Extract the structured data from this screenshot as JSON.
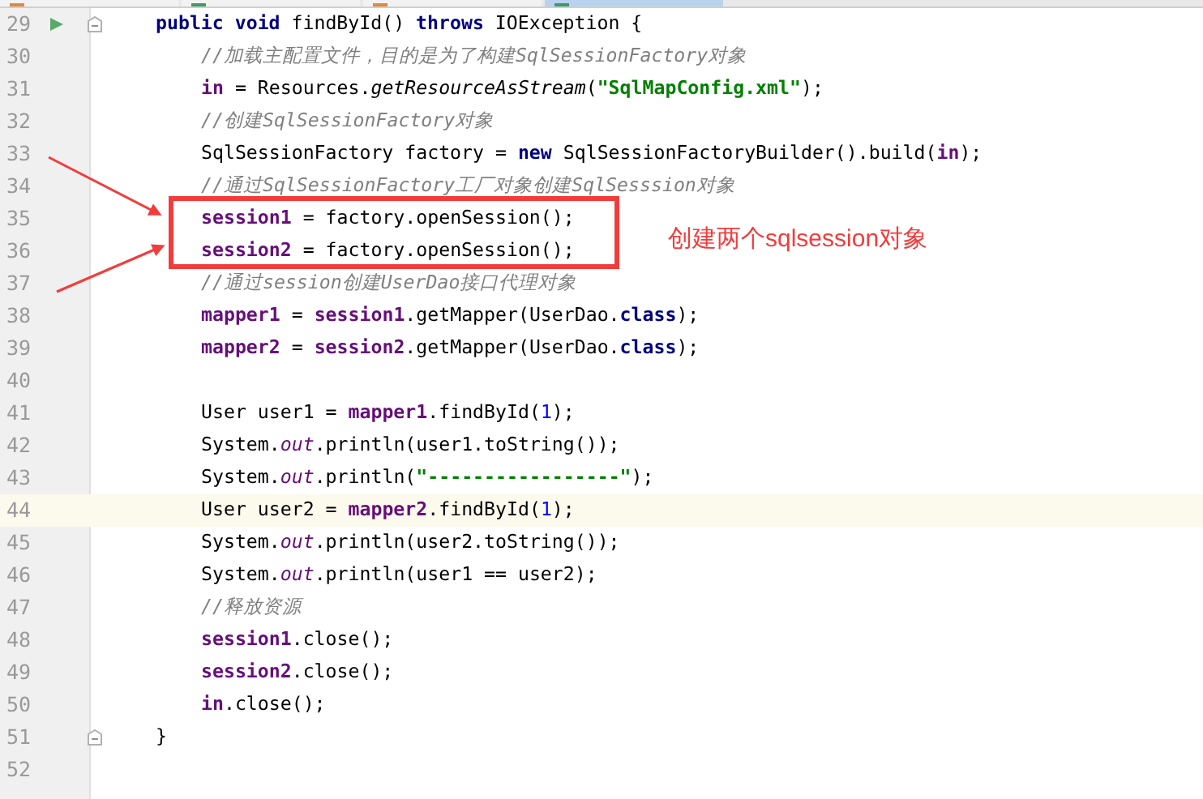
{
  "tabs": [
    {
      "kind": "xml",
      "selected": false
    },
    {
      "kind": "java",
      "selected": false
    },
    {
      "kind": "xml",
      "selected": false
    },
    {
      "kind": "java",
      "selected": true
    }
  ],
  "lines": [
    {
      "number": "29",
      "run_marker": true,
      "fold": true,
      "highlighted": false,
      "segments": [
        {
          "kind": "keyword",
          "text": "public void"
        },
        {
          "kind": "plain",
          "text": " findById() "
        },
        {
          "kind": "keyword",
          "text": "throws"
        },
        {
          "kind": "plain",
          "text": " IOException {"
        }
      ],
      "children": [
        {
          "number": "30",
          "run_marker": false,
          "fold": false,
          "highlighted": false,
          "segments": [
            {
              "kind": "comment",
              "text": "//加载主配置文件，目的是为了构建SqlSessionFactory对象"
            }
          ]
        },
        {
          "number": "31",
          "run_marker": false,
          "fold": false,
          "highlighted": false,
          "segments": [
            {
              "kind": "field",
              "text": "in"
            },
            {
              "kind": "plain",
              "text": " = Resources."
            },
            {
              "kind": "italic",
              "text": "getResourceAsStream"
            },
            {
              "kind": "plain",
              "text": "("
            },
            {
              "kind": "string",
              "text": "\"SqlMapConfig.xml\""
            },
            {
              "kind": "plain",
              "text": ");"
            }
          ]
        },
        {
          "number": "32",
          "run_marker": false,
          "fold": false,
          "highlighted": false,
          "segments": [
            {
              "kind": "comment",
              "text": "//创建SqlSessionFactory对象"
            }
          ]
        },
        {
          "number": "33",
          "run_marker": false,
          "fold": false,
          "highlighted": false,
          "segments": [
            {
              "kind": "plain",
              "text": "SqlSessionFactory factory = "
            },
            {
              "kind": "keyword",
              "text": "new"
            },
            {
              "kind": "plain",
              "text": " SqlSessionFactoryBuilder().build("
            },
            {
              "kind": "field",
              "text": "in"
            },
            {
              "kind": "plain",
              "text": ");"
            }
          ]
        },
        {
          "number": "34",
          "run_marker": false,
          "fold": false,
          "highlighted": false,
          "segments": [
            {
              "kind": "comment",
              "text": "//通过SqlSessionFactory工厂对象创建SqlSesssion对象"
            }
          ]
        },
        {
          "number": "35",
          "run_marker": false,
          "fold": false,
          "highlighted": false,
          "segments": [
            {
              "kind": "field",
              "text": "session1"
            },
            {
              "kind": "plain",
              "text": " = factory.openSession();"
            }
          ]
        },
        {
          "number": "36",
          "run_marker": false,
          "fold": false,
          "highlighted": false,
          "segments": [
            {
              "kind": "field",
              "text": "session2"
            },
            {
              "kind": "plain",
              "text": " = factory.openSession();"
            }
          ]
        },
        {
          "number": "37",
          "run_marker": false,
          "fold": false,
          "highlighted": false,
          "segments": [
            {
              "kind": "comment",
              "text": "//通过session创建UserDao接口代理对象"
            }
          ]
        },
        {
          "number": "38",
          "run_marker": false,
          "fold": false,
          "highlighted": false,
          "segments": [
            {
              "kind": "field",
              "text": "mapper1"
            },
            {
              "kind": "plain",
              "text": " = "
            },
            {
              "kind": "field",
              "text": "session1"
            },
            {
              "kind": "plain",
              "text": ".getMapper(UserDao."
            },
            {
              "kind": "keyword",
              "text": "class"
            },
            {
              "kind": "plain",
              "text": ");"
            }
          ]
        },
        {
          "number": "39",
          "run_marker": false,
          "fold": false,
          "highlighted": false,
          "segments": [
            {
              "kind": "field",
              "text": "mapper2"
            },
            {
              "kind": "plain",
              "text": " = "
            },
            {
              "kind": "field",
              "text": "session2"
            },
            {
              "kind": "plain",
              "text": ".getMapper(UserDao."
            },
            {
              "kind": "keyword",
              "text": "class"
            },
            {
              "kind": "plain",
              "text": ");"
            }
          ]
        },
        {
          "number": "40",
          "run_marker": false,
          "fold": false,
          "highlighted": false
        },
        {
          "number": "41",
          "run_marker": false,
          "fold": false,
          "highlighted": false,
          "segments": [
            {
              "kind": "plain",
              "text": "User user1 = "
            },
            {
              "kind": "field",
              "text": "mapper1"
            },
            {
              "kind": "plain",
              "text": ".findById("
            },
            {
              "kind": "number",
              "text": "1"
            },
            {
              "kind": "plain",
              "text": ");"
            }
          ]
        },
        {
          "number": "42",
          "run_marker": false,
          "fold": false,
          "highlighted": false,
          "segments": [
            {
              "kind": "plain",
              "text": "System."
            },
            {
              "kind": "static",
              "text": "out"
            },
            {
              "kind": "plain",
              "text": ".println(user1.toString());"
            }
          ]
        },
        {
          "number": "43",
          "run_marker": false,
          "fold": false,
          "highlighted": false,
          "segments": [
            {
              "kind": "plain",
              "text": "System."
            },
            {
              "kind": "static",
              "text": "out"
            },
            {
              "kind": "plain",
              "text": ".println("
            },
            {
              "kind": "string",
              "text": "\"-----------------\""
            },
            {
              "kind": "plain",
              "text": ");"
            }
          ]
        },
        {
          "number": "44",
          "run_marker": false,
          "fold": false,
          "highlighted": true,
          "segments": [
            {
              "kind": "plain",
              "text": "User user2 = "
            },
            {
              "kind": "field",
              "text": "mapper2"
            },
            {
              "kind": "plain",
              "text": ".findById("
            },
            {
              "kind": "number",
              "text": "1"
            },
            {
              "kind": "plain",
              "text": ");"
            }
          ]
        },
        {
          "number": "45",
          "run_marker": false,
          "fold": false,
          "highlighted": false,
          "segments": [
            {
              "kind": "plain",
              "text": "System."
            },
            {
              "kind": "static",
              "text": "out"
            },
            {
              "kind": "plain",
              "text": ".println(user2.toString());"
            }
          ]
        },
        {
          "number": "46",
          "run_marker": false,
          "fold": false,
          "highlighted": false,
          "segments": [
            {
              "kind": "plain",
              "text": "System."
            },
            {
              "kind": "static",
              "text": "out"
            },
            {
              "kind": "plain",
              "text": ".println(user1 == user2);"
            }
          ]
        },
        {
          "number": "47",
          "run_marker": false,
          "fold": false,
          "highlighted": false,
          "segments": [
            {
              "kind": "comment",
              "text": "//释放资源"
            }
          ]
        },
        {
          "number": "48",
          "run_marker": false,
          "fold": false,
          "highlighted": false,
          "segments": [
            {
              "kind": "field",
              "text": "session1"
            },
            {
              "kind": "plain",
              "text": ".close();"
            }
          ]
        },
        {
          "number": "49",
          "run_marker": false,
          "fold": false,
          "highlighted": false,
          "segments": [
            {
              "kind": "field",
              "text": "session2"
            },
            {
              "kind": "plain",
              "text": ".close();"
            }
          ]
        },
        {
          "number": "50",
          "run_marker": false,
          "fold": false,
          "highlighted": false,
          "segments": [
            {
              "kind": "field",
              "text": "in"
            },
            {
              "kind": "plain",
              "text": ".close();"
            }
          ]
        }
      ]
    },
    {
      "number": "51",
      "run_marker": false,
      "fold": true,
      "highlighted": false,
      "segments": [
        {
          "kind": "plain",
          "text": "}"
        }
      ]
    },
    {
      "number": "52",
      "run_marker": false,
      "fold": false,
      "highlighted": false
    }
  ],
  "annotation": {
    "text": "创建两个sqlsession对象"
  }
}
